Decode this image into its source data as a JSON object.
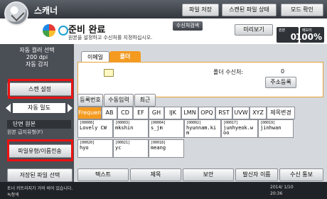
{
  "app": {
    "title": "스캐너"
  },
  "top_buttons": [
    "파일 저장",
    "스캔된 파일 상태",
    "모드 확인"
  ],
  "status": {
    "ready_text": "준비 완료",
    "hint": "원본을 설정하고 수신처를 지정하십시오.",
    "dest_search": "수신처검색",
    "preview": "미리보기",
    "originals_label": "원본",
    "originals_value": "0",
    "memory_label": "메모리",
    "memory_value": "100%"
  },
  "left": {
    "info": [
      "자동 컬러 선택",
      "200 dpi",
      "자동 감지"
    ],
    "scan_settings": "스캔 설정",
    "density": "자동 밀도",
    "original_feed_label": "단면 원본",
    "original_feed_sub": "원본 급지유형(F)",
    "file_type": "파일유형/이름전송",
    "stored_file": "저장된 파일 선택"
  },
  "tabs": [
    "이메일",
    "폴더"
  ],
  "folder_panel": {
    "dest_label": "폴더 수신처:",
    "dest_count": "0",
    "register": "주소등록"
  },
  "toolbar": [
    "등록번호",
    "수동입력",
    "최근"
  ],
  "filters": [
    "Frequent",
    "AB",
    "CD",
    "EF",
    "GH",
    "IJK",
    "LMN",
    "OPQ",
    "RST",
    "UVW",
    "XYZ",
    "제목변경"
  ],
  "entries": [
    {
      "num": "[00008]",
      "name": "Lovely CW"
    },
    {
      "num": "[00003]",
      "name": "mkshin"
    },
    {
      "num": "[00004]",
      "name": "s_jm"
    },
    {
      "num": "[00002]",
      "name": "hyunnam.ki m"
    },
    {
      "num": "[00017]",
      "name": "junhyeok.w oo"
    },
    {
      "num": "[00019]",
      "name": "jinhwan"
    },
    {
      "num": "[00020]",
      "name": "hyo"
    },
    {
      "num": "[00021]",
      "name": "yc"
    },
    {
      "num": "[00018]",
      "name": "meang"
    }
  ],
  "bottom_buttons": [
    "텍스트",
    "제목",
    "보안",
    "발신자 이름",
    "수신 통보"
  ],
  "footer": {
    "msg1": "토너 카트리지가 거의 비어 있습니다.",
    "msg2": "녹청색",
    "date": "2014/ 1/10",
    "time": "20:36"
  }
}
